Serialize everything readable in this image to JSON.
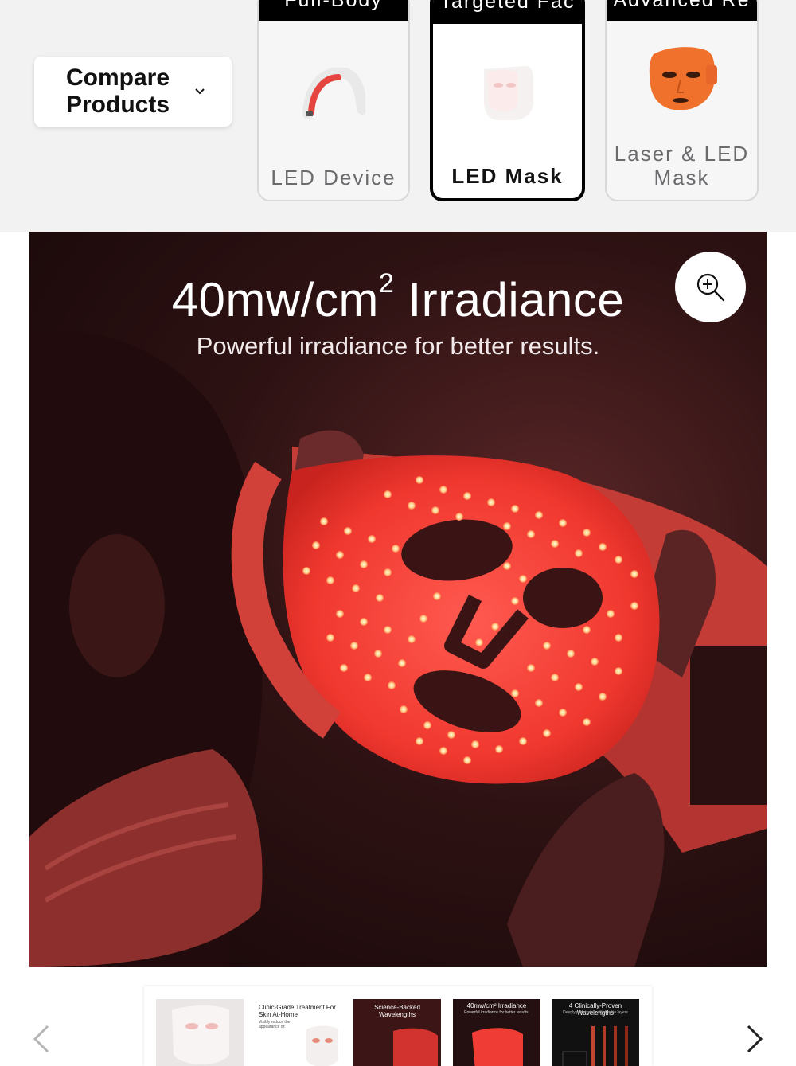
{
  "compare": {
    "dropdown_label": "Compare Products",
    "cards": [
      {
        "banner": "Full-Body",
        "name": "LED Device",
        "selected": false
      },
      {
        "banner": "Targeted Fac",
        "name": "LED Mask",
        "selected": true
      },
      {
        "banner": "Advanced Re",
        "name": "Laser & LED Mask",
        "selected": false
      }
    ]
  },
  "hero": {
    "title_main": "40mw/cm",
    "title_sup": "2",
    "title_rest": " Irradiance",
    "subtitle": "Powerful irradiance for better results."
  },
  "gallery": {
    "thumbs": [
      {
        "title": "",
        "subtitle": ""
      },
      {
        "title": "Clinic-Grade Treatment For Skin At-Home",
        "subtitle": "Visibly reduce the appearance of:"
      },
      {
        "title": "Science-Backed Wavelengths",
        "subtitle": ""
      },
      {
        "title": "40mw/cm² Irradiance",
        "subtitle": "Powerful irradiance for better results."
      },
      {
        "title": "4 Clinically-Proven Wavelengths",
        "subtitle": "Deeply penetrate multiple skin layers"
      }
    ]
  },
  "colors": {
    "led_red": "#e8332f",
    "mask_glow": "#ff4a44",
    "hero_bg": "#2e1213"
  }
}
